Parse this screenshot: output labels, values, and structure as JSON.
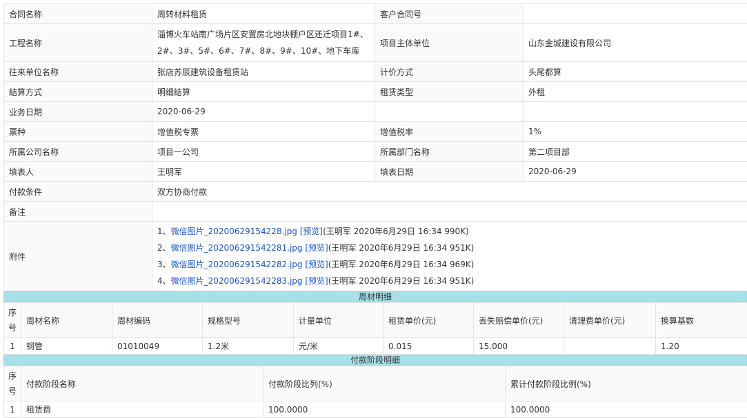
{
  "main_rows": {
    "contract_name_label": "合同名称",
    "contract_name": "周转材料租赁",
    "customer_contract_label": "客户合同号",
    "customer_contract": "",
    "project_label": "工程名称",
    "project_line1": "淄博火车站南广场片区安置房北地块棚户区还迁项目1#、",
    "project_line2": "2#、3#、5#、6#、7#、8#、9#、10#、地下车库",
    "project_owner_label": "项目主体单位",
    "project_owner": "山东金城建设有限公司",
    "partner_label": "往来单位名称",
    "partner": "张店苏辰建筑设备租赁站",
    "pricing_label": "计价方式",
    "pricing": "头尾都算",
    "settlement_label": "结算方式",
    "settlement": "明细结算",
    "lease_type_label": "租赁类型",
    "lease_type": "外租",
    "business_date_label": "业务日期",
    "business_date": "2020-06-29",
    "invoice_label": "票种",
    "invoice": "增值税专票",
    "vat_label": "增值税率",
    "vat": "1%",
    "company_label": "所属公司名称",
    "company": "项目一公司",
    "department_label": "所属部门名称",
    "department": "第二项目部",
    "filler_label": "填表人",
    "filler": "王明军",
    "fill_date_label": "填表日期",
    "fill_date": "2020-06-29",
    "payment_terms_label": "付款条件",
    "payment_terms": "双方协商付款",
    "remarks_label": "备注",
    "remarks": "",
    "attachments_label": "附件"
  },
  "attachments": [
    {
      "index": "1、",
      "file": "微信图片_20200629154228.jpg",
      "preview": "[预览]",
      "meta": "(王明军 2020年6月29日 16:34 990K)"
    },
    {
      "index": "2、",
      "file": "微信图片_202006291542281.jpg",
      "preview": "[预览]",
      "meta": "(王明军 2020年6月29日 16:34 951K)"
    },
    {
      "index": "3、",
      "file": "微信图片_202006291542282.jpg",
      "preview": "[预览]",
      "meta": "(王明军 2020年6月29日 16:34 969K)"
    },
    {
      "index": "4、",
      "file": "微信图片_202006291542283.jpg",
      "preview": "[预览]",
      "meta": "(王明军 2020年6月29日 16:34 951K)"
    }
  ],
  "materials": {
    "section_title": "周材明细",
    "headers": [
      "序号",
      "周材名称",
      "周材编码",
      "规格型号",
      "计量单位",
      "租赁单价(元)",
      "丢失赔偿单价(元)",
      "清理费单价(元)",
      "换算基数"
    ],
    "rows": [
      [
        "1",
        "钢管",
        "01010049",
        "1.2米",
        "元/米",
        "0.015",
        "15.000",
        "",
        "1.20"
      ]
    ]
  },
  "payment": {
    "section_title": "付款阶段明细",
    "headers": [
      "序号",
      "付款阶段名称",
      "付款阶段比列(%)",
      "累计付款阶段比例(%)"
    ],
    "rows": [
      [
        "1",
        "租赁费",
        "100.0000",
        "100.0000"
      ]
    ]
  }
}
